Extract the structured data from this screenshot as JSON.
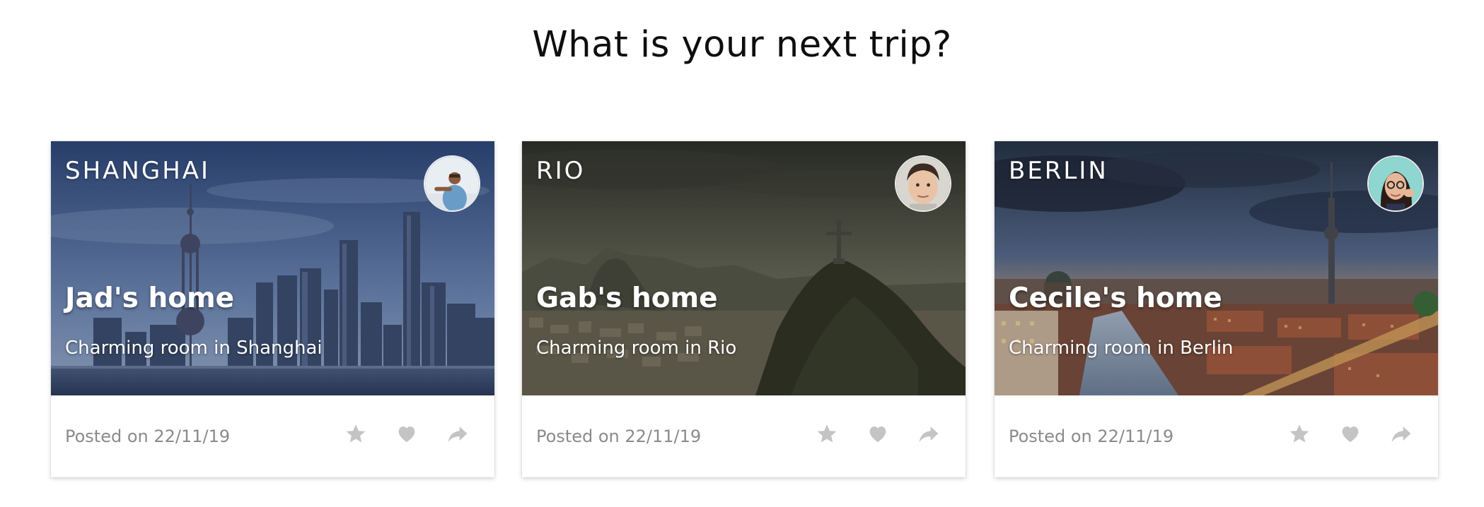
{
  "page": {
    "title": "What is your next trip?"
  },
  "colors": {
    "icon_gray": "#c4c4c4",
    "posted_text": "#8a8a8a"
  },
  "cards": [
    {
      "city": "SHANGHAI",
      "home_title": "Jad's home",
      "subtitle": "Charming room in Shanghai",
      "posted": "Posted on 22/11/19",
      "icons": [
        "star-icon",
        "heart-icon",
        "share-icon"
      ]
    },
    {
      "city": "RIO",
      "home_title": "Gab's home",
      "subtitle": "Charming room in Rio",
      "posted": "Posted on 22/11/19",
      "icons": [
        "star-icon",
        "heart-icon",
        "share-icon"
      ]
    },
    {
      "city": "BERLIN",
      "home_title": "Cecile's home",
      "subtitle": "Charming room in Berlin",
      "posted": "Posted on 22/11/19",
      "icons": [
        "star-icon",
        "heart-icon",
        "share-icon"
      ]
    }
  ]
}
